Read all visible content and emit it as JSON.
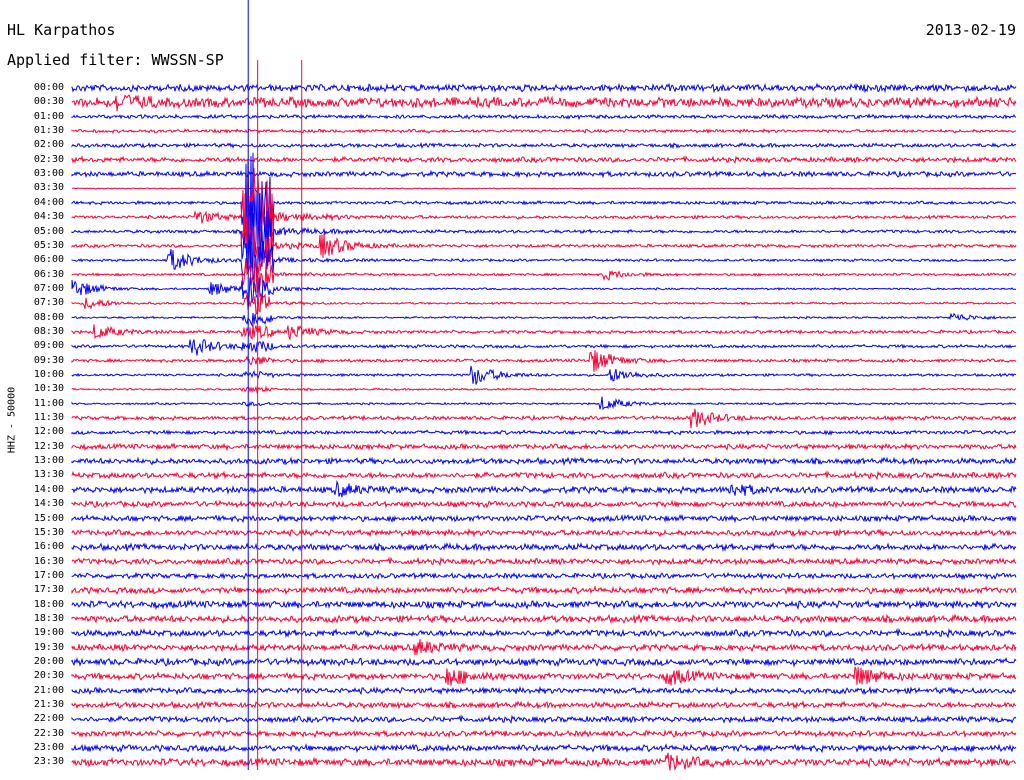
{
  "header": {
    "station": "HL Karpathos",
    "filter": "Applied filter: WWSSN-SP",
    "date": "2013-02-19",
    "channel": "HHZ - 50000"
  },
  "colors": {
    "background": "#ffffff",
    "trace_a": "#0000ff",
    "trace_b": "#ff0033"
  },
  "chart_data": {
    "type": "line",
    "title": "HL Karpathos",
    "subtitle": "Applied filter: WWSSN-SP",
    "date": "2013-02-19",
    "ylabel": "HHZ - 50000",
    "xlabel": "",
    "row_minutes": 30,
    "series_color_order": [
      "blue",
      "red"
    ],
    "row_labels": [
      "00:00",
      "00:30",
      "01:00",
      "01:30",
      "02:00",
      "02:30",
      "03:00",
      "03:30",
      "04:00",
      "04:30",
      "05:00",
      "05:30",
      "06:00",
      "06:30",
      "07:00",
      "07:30",
      "08:00",
      "08:30",
      "09:00",
      "09:30",
      "10:00",
      "10:30",
      "11:00",
      "11:30",
      "12:00",
      "12:30",
      "13:00",
      "13:30",
      "14:00",
      "14:30",
      "15:00",
      "15:30",
      "16:00",
      "16:30",
      "17:00",
      "17:30",
      "18:00",
      "18:30",
      "19:00",
      "19:30",
      "20:00",
      "20:30",
      "21:00",
      "21:30",
      "22:00",
      "22:30",
      "23:00",
      "23:30"
    ],
    "noise_amplitude": [
      1.1,
      1.6,
      0.6,
      0.5,
      0.6,
      0.8,
      0.8,
      0.15,
      0.5,
      0.5,
      0.5,
      0.5,
      0.4,
      0.4,
      0.3,
      0.3,
      0.3,
      0.5,
      0.5,
      0.5,
      0.4,
      0.3,
      0.3,
      0.6,
      0.6,
      0.8,
      0.9,
      0.9,
      1.0,
      0.9,
      0.9,
      0.9,
      1.0,
      0.9,
      0.8,
      1.0,
      1.1,
      1.1,
      1.0,
      1.0,
      1.1,
      1.0,
      0.9,
      0.9,
      0.9,
      0.9,
      1.0,
      1.2
    ],
    "events": [
      {
        "row": 1,
        "minute": 1.5,
        "amplitude": 3.0
      },
      {
        "row": 9,
        "minute": 4.0,
        "amplitude": 3.0
      },
      {
        "row": 11,
        "minute": 8.0,
        "amplitude": 5.0
      },
      {
        "row": 12,
        "minute": 3.2,
        "amplitude": 5.0
      },
      {
        "row": 13,
        "minute": 17.0,
        "amplitude": 2.0
      },
      {
        "row": 14,
        "minute": 4.5,
        "amplitude": 3.0
      },
      {
        "row": 14,
        "minute": 0.0,
        "amplitude": 5.0
      },
      {
        "row": 15,
        "minute": 0.5,
        "amplitude": 2.5
      },
      {
        "row": 16,
        "minute": 28.0,
        "amplitude": 2.0
      },
      {
        "row": 17,
        "minute": 0.8,
        "amplitude": 3.0
      },
      {
        "row": 17,
        "minute": 7.0,
        "amplitude": 3.0
      },
      {
        "row": 18,
        "minute": 3.9,
        "amplitude": 4.0
      },
      {
        "row": 19,
        "minute": 16.6,
        "amplitude": 5.0
      },
      {
        "row": 20,
        "minute": 12.8,
        "amplitude": 4.5
      },
      {
        "row": 20,
        "minute": 17.2,
        "amplitude": 3.0
      },
      {
        "row": 22,
        "minute": 16.9,
        "amplitude": 3.0
      },
      {
        "row": 23,
        "minute": 19.8,
        "amplitude": 4.0
      },
      {
        "row": 28,
        "minute": 8.5,
        "amplitude": 2.5
      },
      {
        "row": 28,
        "minute": 21.0,
        "amplitude": 2.5
      },
      {
        "row": 39,
        "minute": 11.0,
        "amplitude": 3.0
      },
      {
        "row": 41,
        "minute": 12.0,
        "amplitude": 4.0
      },
      {
        "row": 41,
        "minute": 19.0,
        "amplitude": 3.5
      },
      {
        "row": 41,
        "minute": 25.0,
        "amplitude": 4.0
      },
      {
        "row": 47,
        "minute": 19.0,
        "amplitude": 3.0
      }
    ],
    "main_event": {
      "row": 8,
      "minute": 5.5,
      "peak_amplitude": 50,
      "coda_rows": 14
    }
  }
}
